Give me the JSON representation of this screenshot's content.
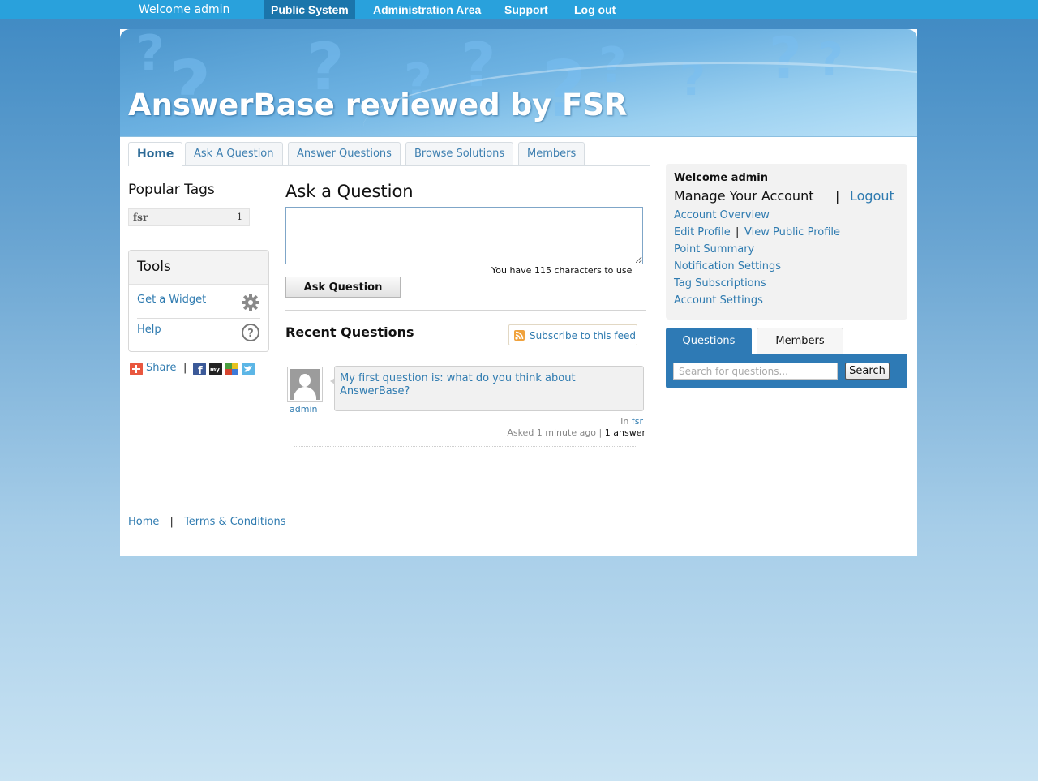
{
  "topbar": {
    "welcome": "Welcome admin",
    "items": [
      "Public System",
      "Administration Area",
      "Support",
      "Log out"
    ]
  },
  "banner": {
    "title": "AnswerBase reviewed by FSR"
  },
  "tabs": [
    "Home",
    "Ask A Question",
    "Answer Questions",
    "Browse Solutions",
    "Members"
  ],
  "popular_tags": {
    "title": "Popular Tags",
    "tags": [
      {
        "name": "fsr",
        "count": "1"
      }
    ]
  },
  "tools": {
    "title": "Tools",
    "items": [
      "Get a Widget",
      "Help"
    ],
    "icons": [
      "gear-icon",
      "question-circle-icon"
    ]
  },
  "share": {
    "label": "Share",
    "separator": "|",
    "icons": [
      "facebook-icon",
      "myspace-icon",
      "google-icon",
      "twitter-icon"
    ]
  },
  "ask": {
    "title": "Ask a Question",
    "placeholder": "",
    "chars_note": "You have 115 characters to use",
    "button": "Ask Question"
  },
  "recent": {
    "title": "Recent Questions",
    "feed_label": "Subscribe to this feed",
    "questions": [
      {
        "author": "admin",
        "text": "My first question is: what do you think about AnswerBase?",
        "in_label": "In",
        "tag": "fsr",
        "asked": "Asked 1 minute ago",
        "separator": "|",
        "answers": "1 answer"
      }
    ]
  },
  "account": {
    "welcome": "Welcome admin",
    "manage": "Manage Your Account",
    "separator": "|",
    "logout": "Logout",
    "links": [
      "Account Overview",
      "Edit Profile",
      "View Public Profile",
      "Point Summary",
      "Notification Settings",
      "Tag Subscriptions",
      "Account Settings"
    ]
  },
  "search": {
    "tabs": [
      "Questions",
      "Members"
    ],
    "placeholder": "Search for questions...",
    "button": "Search"
  },
  "footer": {
    "links": [
      "Home",
      "Terms & Conditions"
    ],
    "separator": "|"
  },
  "colors": {
    "topbar": "#29a1dc",
    "accent": "#2e7ab5",
    "link": "#2f7bb0"
  }
}
